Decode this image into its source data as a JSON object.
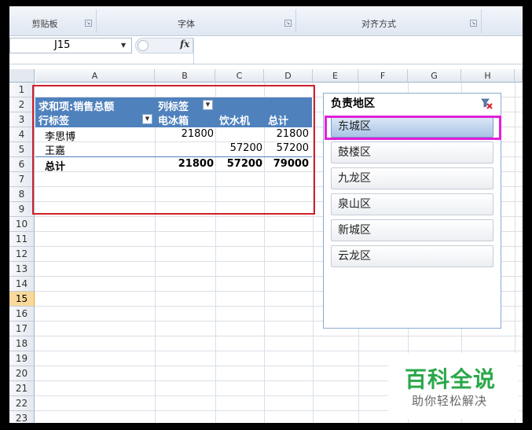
{
  "ribbon": {
    "groups": [
      "剪贴板",
      "字体",
      "对齐方式"
    ]
  },
  "formula_bar": {
    "name_box": "J15",
    "fx_label": "fx",
    "formula": ""
  },
  "grid": {
    "columns": [
      "A",
      "B",
      "C",
      "D",
      "E",
      "F",
      "G",
      "H"
    ],
    "rows": [
      "1",
      "2",
      "3",
      "4",
      "5",
      "6",
      "7",
      "8",
      "9",
      "10",
      "11",
      "12",
      "13",
      "14",
      "15",
      "16",
      "17",
      "18",
      "19",
      "20",
      "21",
      "22",
      "23"
    ],
    "active_row": "15"
  },
  "pivot": {
    "value_field": "求和项:销售总额",
    "col_label": "列标签",
    "row_label": "行标签",
    "col_headers": [
      "电冰箱",
      "饮水机",
      "总计"
    ],
    "rows": [
      {
        "name": "李思博",
        "fridge": "21800",
        "dispenser": "",
        "total": "21800"
      },
      {
        "name": "王嘉",
        "fridge": "",
        "dispenser": "57200",
        "total": "57200"
      }
    ],
    "grand_total": {
      "name": "总计",
      "fridge": "21800",
      "dispenser": "57200",
      "total": "79000"
    }
  },
  "slicer": {
    "title": "负责地区",
    "items": [
      "东城区",
      "鼓楼区",
      "九龙区",
      "泉山区",
      "新城区",
      "云龙区"
    ],
    "selected": "东城区"
  },
  "watermark": {
    "title": "百科全说",
    "subtitle": "助你轻松解决"
  }
}
